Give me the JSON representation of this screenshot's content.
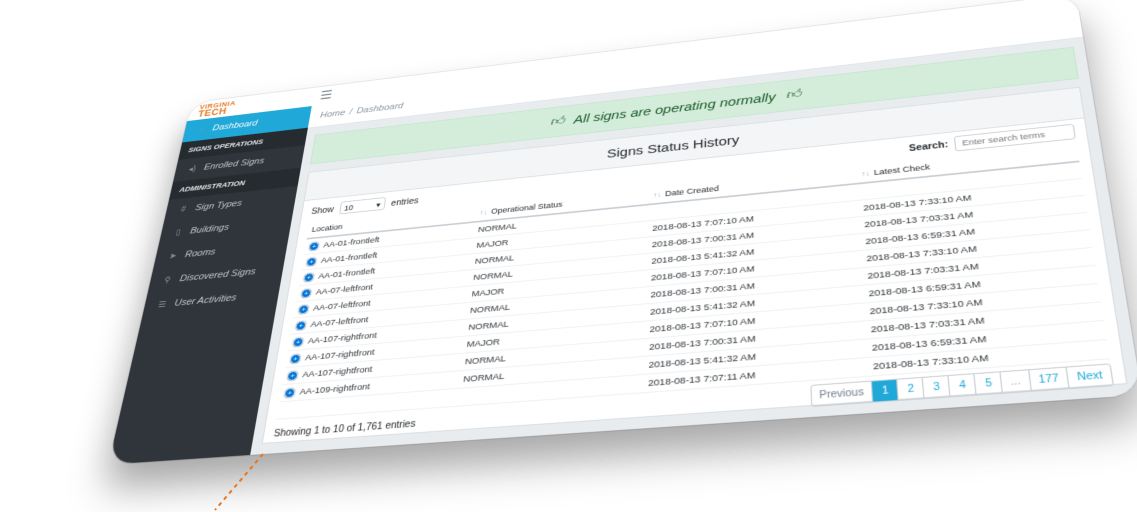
{
  "brand": {
    "line1": "VIRGINIA",
    "line2": "TECH"
  },
  "sidebar": {
    "items": [
      {
        "label": "Dashboard",
        "icon": "speedometer-icon",
        "active": true
      },
      {
        "section": "SIGNS OPERATIONS"
      },
      {
        "label": "Enrolled Signs",
        "icon": "volume-icon"
      },
      {
        "section": "ADMINISTRATION"
      },
      {
        "label": "Sign Types",
        "icon": "grid-icon"
      },
      {
        "label": "Buildings",
        "icon": "building-icon"
      },
      {
        "label": "Rooms",
        "icon": "location-arrow-icon"
      },
      {
        "label": "Discovered Signs",
        "icon": "magnifier-icon"
      },
      {
        "label": "User Activities",
        "icon": "list-icon"
      }
    ]
  },
  "breadcrumb": {
    "home": "Home",
    "separator": "/",
    "current": "Dashboard"
  },
  "alert": {
    "text": "All signs are operating normally"
  },
  "card": {
    "title": "Signs Status History"
  },
  "controls": {
    "show_label": "Show",
    "entries_value": "10",
    "entries_label": "entries",
    "search_label": "Search:",
    "search_placeholder": "Enter search terms"
  },
  "table": {
    "headers": [
      "Location",
      "Operational Status",
      "Date Created",
      "Latest Check"
    ],
    "rows": [
      [
        "AA-01-frontleft",
        "NORMAL",
        "",
        ""
      ],
      [
        "AA-01-frontleft",
        "MAJOR",
        "2018-08-13 7:07:10 AM",
        "2018-08-13 7:33:10 AM"
      ],
      [
        "AA-01-frontleft",
        "NORMAL",
        "2018-08-13 7:00:31 AM",
        "2018-08-13 7:03:31 AM"
      ],
      [
        "AA-07-leftfront",
        "NORMAL",
        "2018-08-13 5:41:32 AM",
        "2018-08-13 6:59:31 AM"
      ],
      [
        "AA-07-leftfront",
        "MAJOR",
        "2018-08-13 7:07:10 AM",
        "2018-08-13 7:33:10 AM"
      ],
      [
        "AA-07-leftfront",
        "NORMAL",
        "2018-08-13 7:00:31 AM",
        "2018-08-13 7:03:31 AM"
      ],
      [
        "AA-107-rightfront",
        "NORMAL",
        "2018-08-13 5:41:32 AM",
        "2018-08-13 6:59:31 AM"
      ],
      [
        "AA-107-rightfront",
        "MAJOR",
        "2018-08-13 7:07:10 AM",
        "2018-08-13 7:33:10 AM"
      ],
      [
        "AA-107-rightfront",
        "NORMAL",
        "2018-08-13 7:00:31 AM",
        "2018-08-13 7:03:31 AM"
      ],
      [
        "AA-109-rightfront",
        "NORMAL",
        "2018-08-13 5:41:32 AM",
        "2018-08-13 6:59:31 AM"
      ],
      [
        "",
        "",
        "2018-08-13 7:07:11 AM",
        "2018-08-13 7:33:10 AM"
      ]
    ]
  },
  "footer": {
    "info": "Showing 1 to 10 of 1,761 entries",
    "pager": [
      "Previous",
      "1",
      "2",
      "3",
      "4",
      "5",
      "...",
      "177",
      "Next"
    ],
    "active_page": "1"
  },
  "colors": {
    "accent": "#20a8d8",
    "sidebar_bg": "#2f353a",
    "alert_bg": "#d4edda",
    "brand_orange": "#e87722"
  }
}
